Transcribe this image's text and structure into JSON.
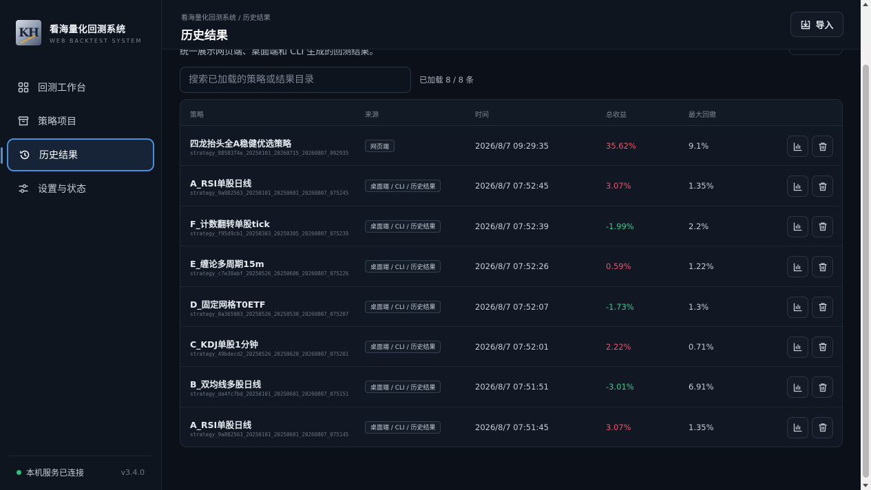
{
  "brand": {
    "logo_text": "KH",
    "title": "看海量化回测系统",
    "subtitle": "WEB BACKTEST SYSTEM"
  },
  "nav": [
    {
      "label": "回测工作台",
      "icon": "dashboard-icon"
    },
    {
      "label": "策略项目",
      "icon": "archive-icon"
    },
    {
      "label": "历史结果",
      "icon": "history-icon",
      "active": true
    },
    {
      "label": "设置与状态",
      "icon": "settings-sliders-icon"
    }
  ],
  "footer": {
    "status": "本机服务已连接",
    "version": "v3.4.0",
    "status_color": "#2ec27e"
  },
  "header": {
    "breadcrumb": "看海量化回测系统 / 历史结果",
    "title": "历史结果",
    "import_label": "导入"
  },
  "cut_description": "统一展示网页端、桌面端和 CLI 生成的回测结果。",
  "search": {
    "placeholder": "搜索已加载的策略或结果目录"
  },
  "loaded_text": "已加载 8 / 8 条",
  "table": {
    "headers": [
      "策略",
      "来源",
      "时间",
      "总收益",
      "最大回撤"
    ],
    "rows": [
      {
        "name": "四龙抬头全A稳健优选策略",
        "dir": "strategy_8858374e_20250101_20260715_20260807_092935",
        "source": "网页端",
        "time": "2026/8/7 09:29:35",
        "return": "35.62%",
        "positive": true,
        "drawdown": "9.1%"
      },
      {
        "name": "A_RSI单股日线",
        "dir": "strategy_9a882563_20250101_20250601_20260807_075245",
        "source": "桌面端 / CLI / 历史结果",
        "time": "2026/8/7 07:52:45",
        "return": "3.07%",
        "positive": true,
        "drawdown": "1.35%"
      },
      {
        "name": "F_计数翻转单股tick",
        "dir": "strategy_f95d9cb1_20250303_20250305_20260807_075239",
        "source": "桌面端 / CLI / 历史结果",
        "time": "2026/8/7 07:52:39",
        "return": "-1.99%",
        "positive": false,
        "drawdown": "2.2%"
      },
      {
        "name": "E_缠论多周期15m",
        "dir": "strategy_c7e38abf_20250526_20250606_20260807_075226",
        "source": "桌面端 / CLI / 历史结果",
        "time": "2026/8/7 07:52:26",
        "return": "0.59%",
        "positive": true,
        "drawdown": "1.22%"
      },
      {
        "name": "D_固定网格T0ETF",
        "dir": "strategy_0a365983_20250526_20250530_20260807_075207",
        "source": "桌面端 / CLI / 历史结果",
        "time": "2026/8/7 07:52:07",
        "return": "-1.73%",
        "positive": false,
        "drawdown": "1.3%"
      },
      {
        "name": "C_KDJ单股1分钟",
        "dir": "strategy_49bdecd2_20250526_20250620_20260807_075201",
        "source": "桌面端 / CLI / 历史结果",
        "time": "2026/8/7 07:52:01",
        "return": "2.22%",
        "positive": true,
        "drawdown": "0.71%"
      },
      {
        "name": "B_双均线多股日线",
        "dir": "strategy_da4fc7bd_20250101_20250601_20260807_075151",
        "source": "桌面端 / CLI / 历史结果",
        "time": "2026/8/7 07:51:51",
        "return": "-3.01%",
        "positive": false,
        "drawdown": "6.91%"
      },
      {
        "name": "A_RSI单股日线",
        "dir": "strategy_9a882563_20250101_20250601_20260807_075145",
        "source": "桌面端 / CLI / 历史结果",
        "time": "2026/8/7 07:51:45",
        "return": "3.07%",
        "positive": true,
        "drawdown": "1.35%"
      }
    ]
  },
  "row_action_icons": [
    "bar-chart-icon",
    "trash-icon"
  ],
  "colors": {
    "accent": "#4a8fe0",
    "positive": "#f0526a",
    "negative": "#3fc88e"
  }
}
